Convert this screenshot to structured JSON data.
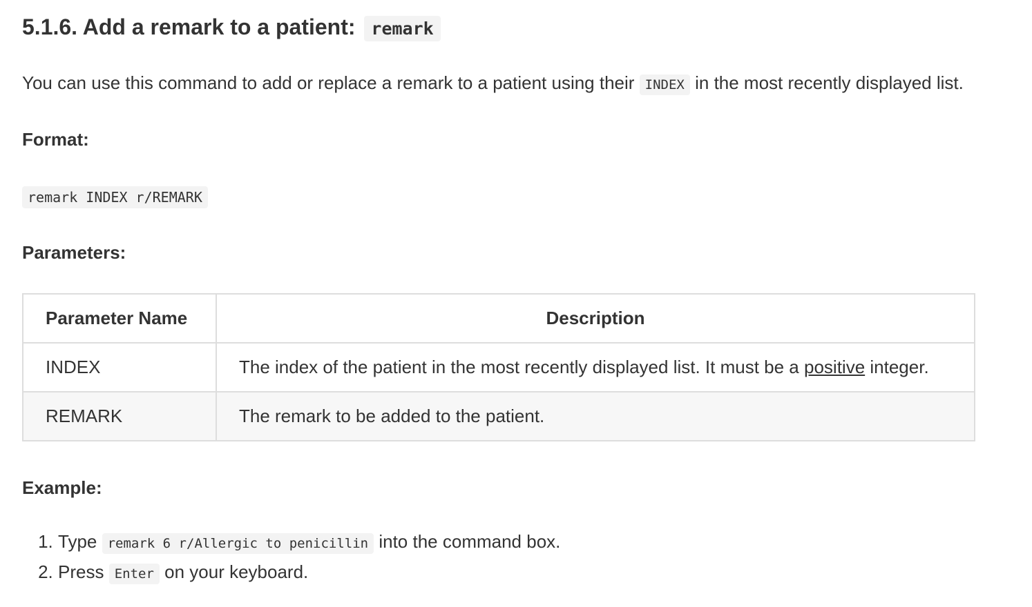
{
  "heading": {
    "text": "5.1.6. Add a remark to a patient:",
    "code": "remark"
  },
  "intro": {
    "before": "You can use this command to add or replace a remark to a patient using their",
    "code": "INDEX",
    "after": "in the most recently displayed list."
  },
  "format": {
    "label": "Format:",
    "code": "remark INDEX r/REMARK"
  },
  "parameters": {
    "label": "Parameters:",
    "headers": [
      "Parameter Name",
      "Description"
    ],
    "rows": [
      {
        "name": "INDEX",
        "desc_before": "The index of the patient in the most recently displayed list. It must be a",
        "desc_link": "positive",
        "desc_after": "integer."
      },
      {
        "name": "REMARK",
        "desc": "The remark to be added to the patient."
      }
    ]
  },
  "example": {
    "label": "Example:",
    "steps": [
      {
        "before": "Type",
        "code": "remark 6 r/Allergic to penicillin",
        "after": "into the command box."
      },
      {
        "before": "Press",
        "code": "Enter",
        "after": "on your keyboard."
      }
    ]
  }
}
